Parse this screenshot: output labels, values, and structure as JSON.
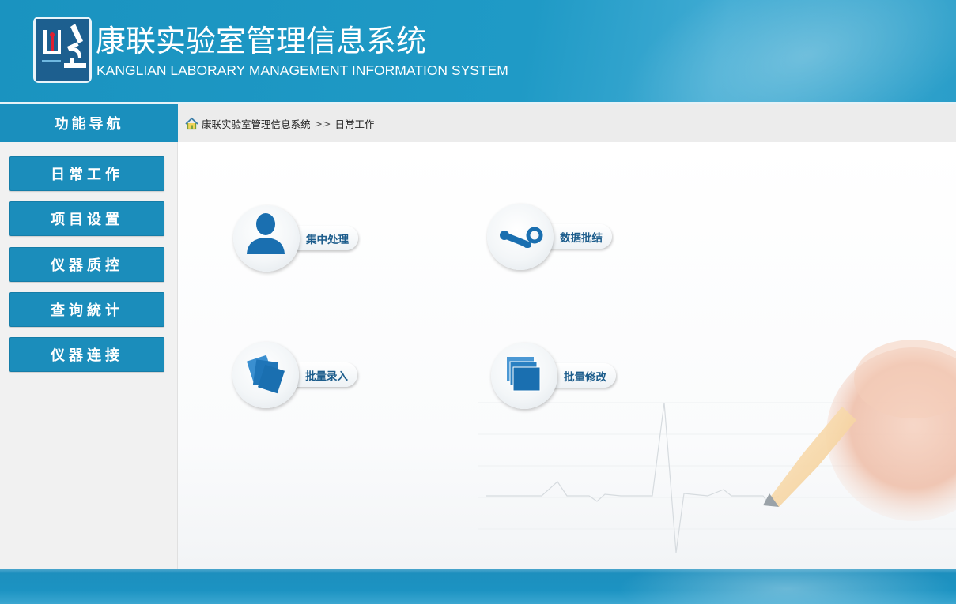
{
  "header": {
    "title": "康联实验室管理信息系统",
    "subtitle": "KANGLIAN LABORARY MANAGEMENT INFORMATION SYSTEM"
  },
  "nav": {
    "title": "功能导航",
    "items": [
      {
        "label": "日常工作"
      },
      {
        "label": "项目设置"
      },
      {
        "label": "仪器质控"
      },
      {
        "label": "查询統计"
      },
      {
        "label": "仪器连接"
      }
    ]
  },
  "breadcrumb": {
    "root": "康联实验室管理信息系统",
    "separator": ">>",
    "current": "日常工作"
  },
  "tiles": [
    {
      "label": "集中处理",
      "icon": "user-icon"
    },
    {
      "label": "数据批结",
      "icon": "steam-link-icon"
    },
    {
      "label": "批量录入",
      "icon": "cards-stack-icon"
    },
    {
      "label": "批量修改",
      "icon": "layers-stack-icon"
    }
  ],
  "colors": {
    "primary": "#1b8dbb",
    "header": "#1f9ac6",
    "icon_blue": "#1a6fb0",
    "tile_text": "#1d5d8c"
  }
}
